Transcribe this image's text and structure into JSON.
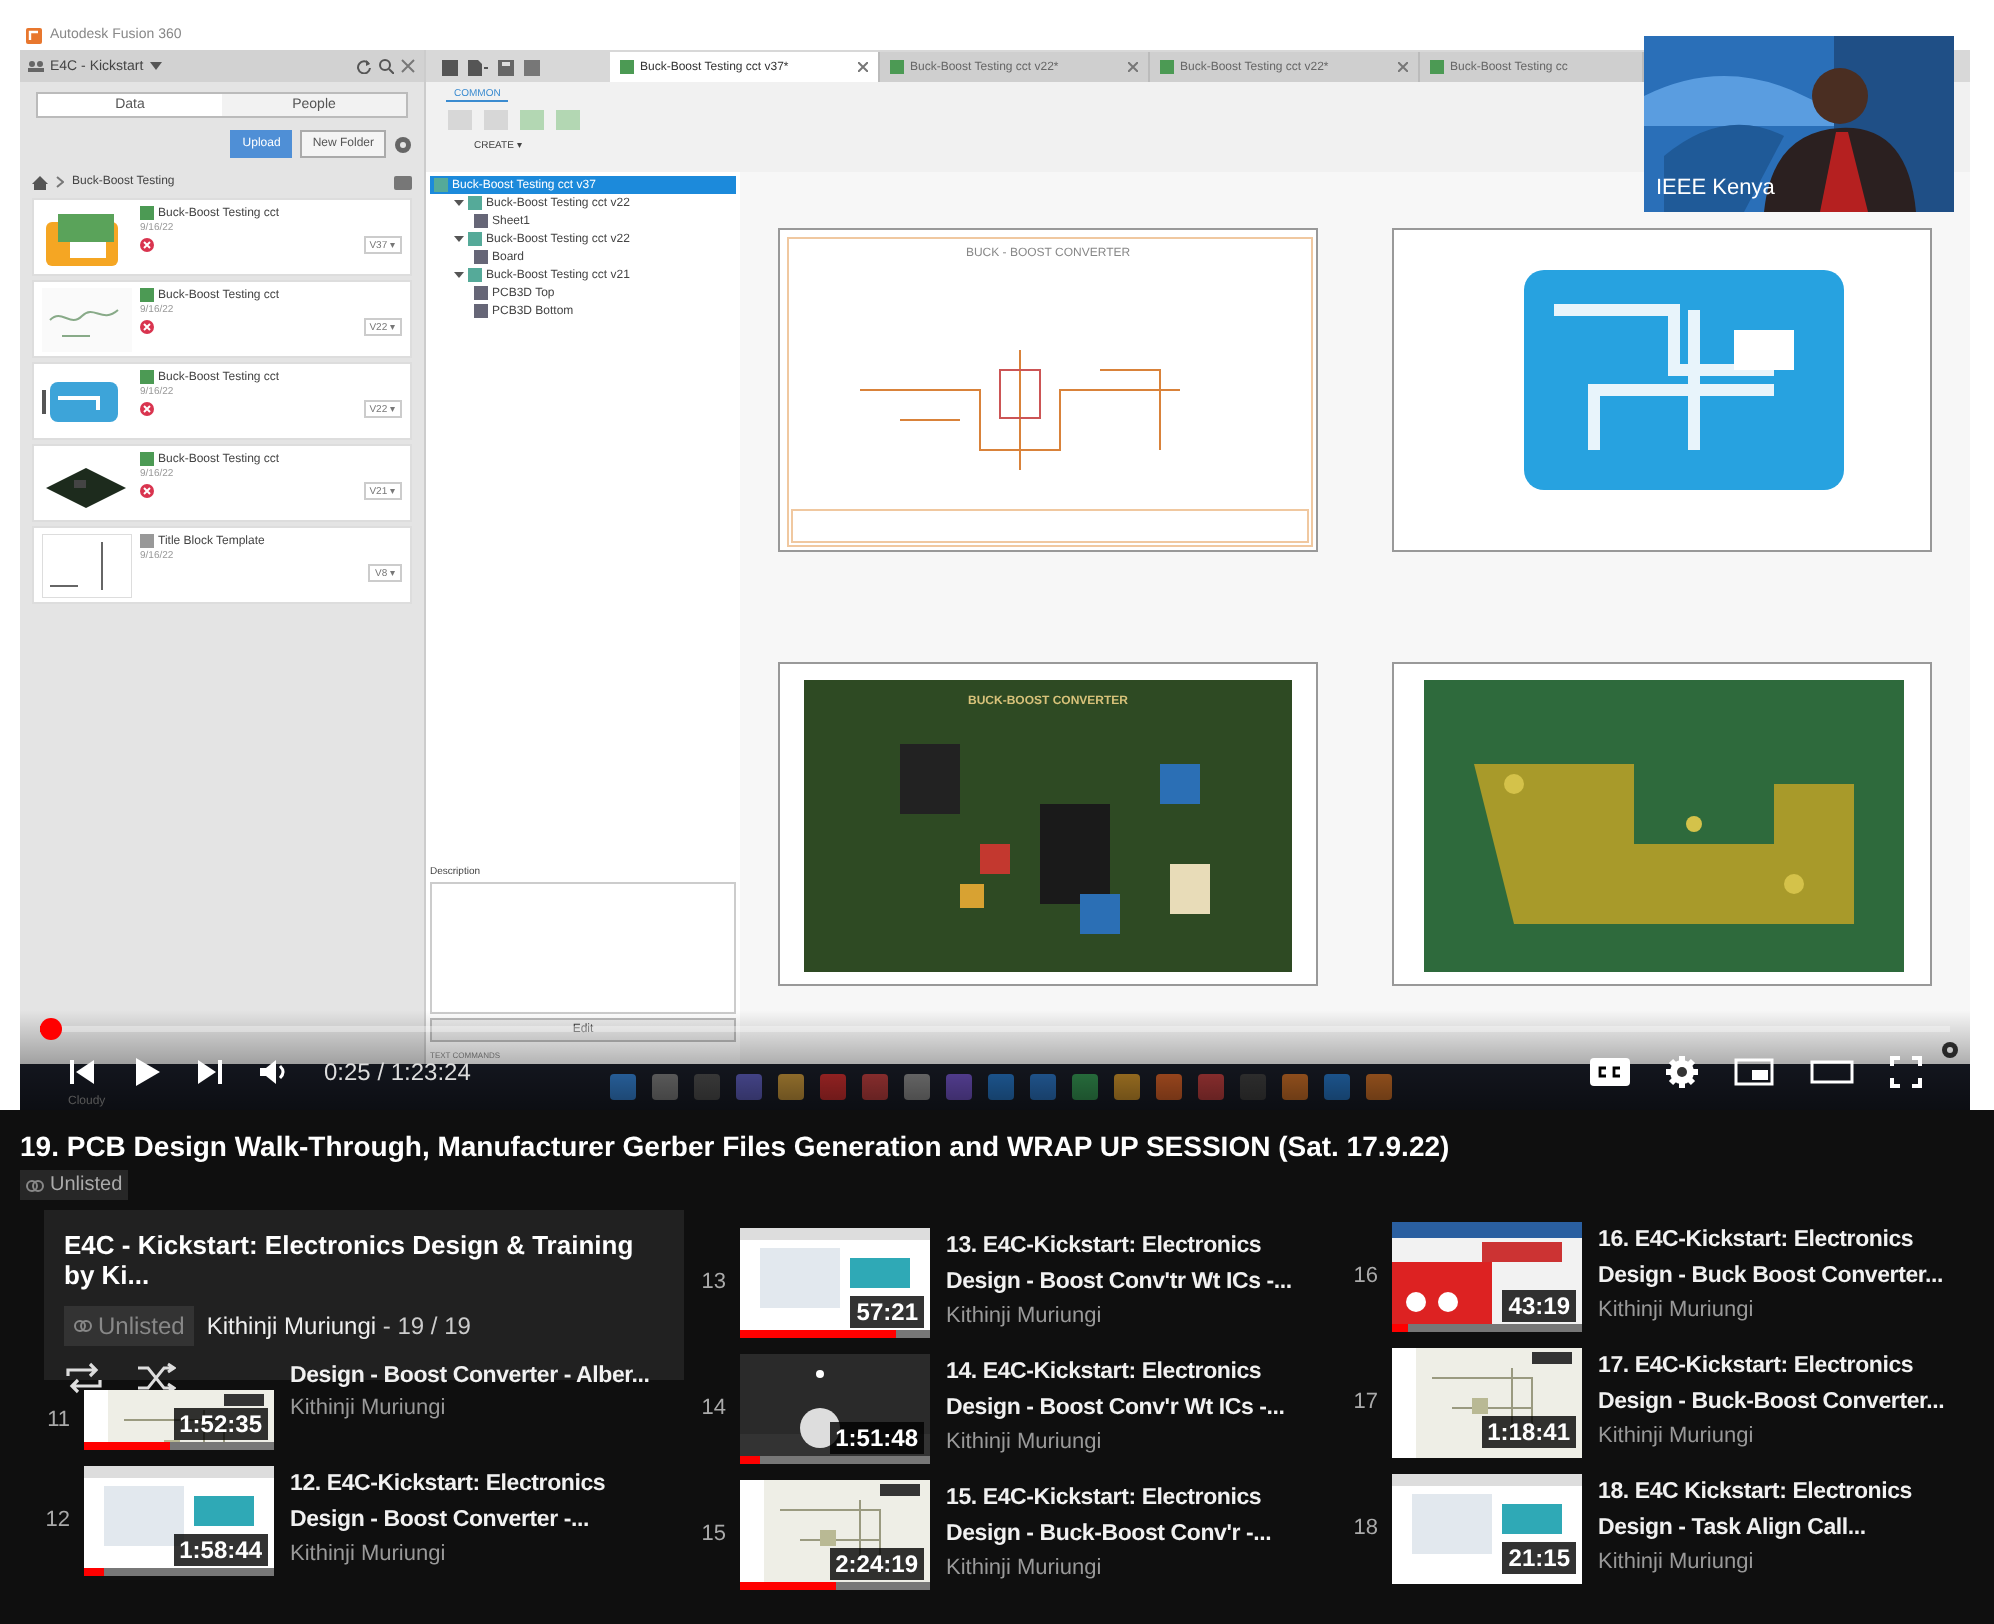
{
  "video": {
    "app": {
      "title": "Autodesk Fusion 360",
      "project": "E4C - Kickstart",
      "panel_tabs": [
        {
          "label": "Data",
          "selected": true
        },
        {
          "label": "People",
          "selected": false
        }
      ],
      "buttons": [
        {
          "label": "Upload",
          "kind": "primary"
        },
        {
          "label": "New Folder",
          "kind": "plain"
        }
      ],
      "breadcrumb": "Buck-Boost Testing",
      "files": [
        {
          "name": "Buck-Boost Testing cct",
          "date": "9/16/22",
          "version": "V37 ▾",
          "kind": "board",
          "error": true
        },
        {
          "name": "Buck-Boost Testing cct",
          "date": "9/16/22",
          "version": "V22 ▾",
          "kind": "schematic",
          "error": true
        },
        {
          "name": "Buck-Boost Testing cct",
          "date": "9/16/22",
          "version": "V22 ▾",
          "kind": "pcb",
          "error": true
        },
        {
          "name": "Buck-Boost Testing cct",
          "date": "9/16/22",
          "version": "V21 ▾",
          "kind": "pcb3d",
          "error": true
        },
        {
          "name": "Title Block Template",
          "date": "9/16/22",
          "version": "V8 ▾",
          "kind": "template",
          "error": false
        }
      ],
      "doc_tabs": [
        {
          "label": "Buck-Boost Testing cct v37*",
          "selected": true
        },
        {
          "label": "Buck-Boost Testing cct v22*",
          "selected": false
        },
        {
          "label": "Buck-Boost Testing cct v22*",
          "selected": false
        },
        {
          "label": "Buck-Boost Testing cc",
          "selected": false
        }
      ],
      "toolbar_tab": "COMMON",
      "toolbar_group": "CREATE ▾",
      "tree": {
        "label": "Buck-Boost Testing cct v37",
        "selected": true,
        "children": [
          {
            "label": "Buck-Boost Testing cct v22",
            "expanded": true,
            "children": [
              {
                "label": "Sheet1"
              }
            ]
          },
          {
            "label": "Buck-Boost Testing cct v22",
            "expanded": true,
            "children": [
              {
                "label": "Board"
              }
            ]
          },
          {
            "label": "Buck-Boost Testing cct v21",
            "expanded": true,
            "children": [
              {
                "label": "PCB3D Top"
              },
              {
                "label": "PCB3D Bottom"
              }
            ]
          }
        ]
      },
      "description_label": "Description",
      "edit_button": "Edit",
      "text_commands": "TEXT COMMANDS",
      "sheets": [
        {
          "kind": "schematic",
          "title": "BUCK - BOOST CONVERTER"
        },
        {
          "kind": "board"
        },
        {
          "kind": "pcb3d",
          "title": "BUCK-BOOST CONVERTER"
        },
        {
          "kind": "bottom"
        }
      ]
    },
    "webcam": {
      "label": "IEEE Kenya"
    },
    "weather": "Cloudy",
    "progress": {
      "level": 0.005
    },
    "time": "0:25 / 1:23:24"
  },
  "title": "19. PCB Design Walk-Through, Manufacturer Gerber Files Generation and WRAP UP SESSION (Sat. 17.9.22)",
  "badge": "Unlisted",
  "playlist": {
    "title": "E4C - Kickstart: Electronics Design & Training by Ki...",
    "badge": "Unlisted",
    "owner": "Kithinji Muriungi",
    "position": " - 19 / 19"
  },
  "columns": [
    [
      {
        "number": "11",
        "title": "Design - Boost Converter - Alber...",
        "channel": "Kithinji Muriungi",
        "duration": "1:52:35",
        "level": 0.45,
        "cut": true
      },
      {
        "number": "12",
        "title": "12. E4C-Kickstart: Electronics Design - Boost Converter -...",
        "channel": "Kithinji Muriungi",
        "duration": "1:58:44",
        "level": 0.1
      }
    ],
    [
      {
        "number": "13",
        "title": "13. E4C-Kickstart: Electronics Design - Boost Conv'tr Wt ICs -...",
        "channel": "Kithinji Muriungi",
        "duration": "57:21",
        "level": 0.82
      },
      {
        "number": "14",
        "title": "14. E4C-Kickstart: Electronics Design - Boost Conv'r Wt ICs -...",
        "channel": "Kithinji Muriungi",
        "duration": "1:51:48",
        "level": 0.1
      },
      {
        "number": "15",
        "title": "15. E4C-Kickstart: Electronics Design - Buck-Boost Conv'r -...",
        "channel": "Kithinji Muriungi",
        "duration": "2:24:19",
        "level": 0.5
      }
    ],
    [
      {
        "number": "16",
        "title": "16. E4C-Kickstart: Electronics Design - Buck Boost Converter...",
        "channel": "Kithinji Muriungi",
        "duration": "43:19",
        "level": 0.08
      },
      {
        "number": "17",
        "title": "17. E4C-Kickstart: Electronics Design - Buck-Boost Converter...",
        "channel": "Kithinji Muriungi",
        "duration": "1:18:41"
      },
      {
        "number": "18",
        "title": "18. E4C Kickstart: Electronics Design - Task Align Call...",
        "channel": "Kithinji Muriungi",
        "duration": "21:15"
      }
    ]
  ]
}
